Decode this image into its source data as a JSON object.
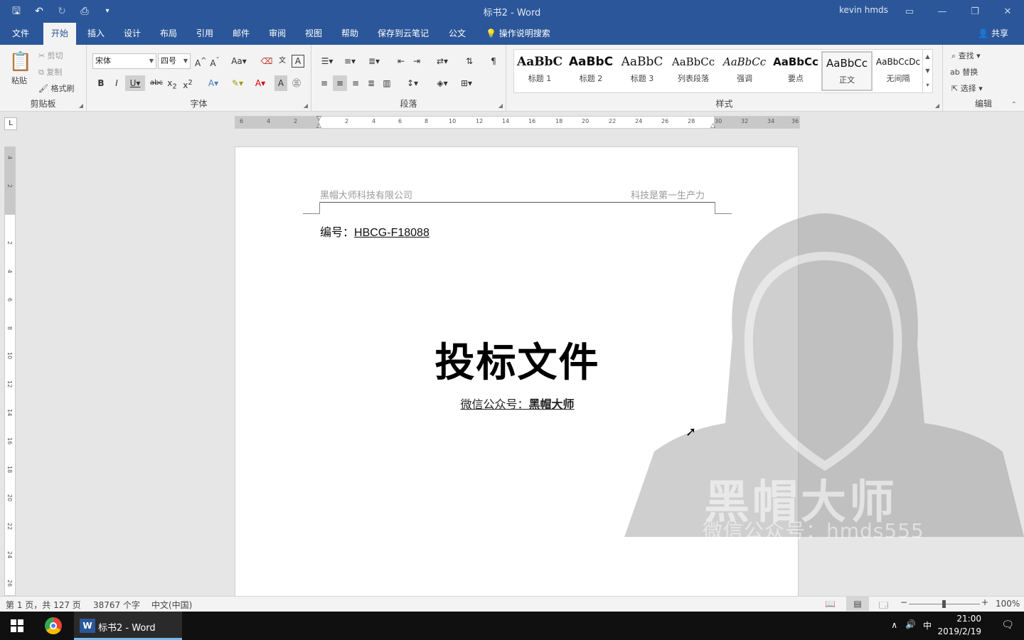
{
  "window": {
    "title": "标书2 - Word",
    "user": "kevin hmds"
  },
  "qat": {
    "save_icon": "save-icon",
    "undo_icon": "undo-icon",
    "redo_icon": "redo-icon",
    "preview_icon": "print-preview-icon",
    "customize_icon": "customize-icon"
  },
  "tabs": [
    "文件",
    "开始",
    "插入",
    "设计",
    "布局",
    "引用",
    "邮件",
    "审阅",
    "视图",
    "帮助",
    "保存到云笔记",
    "公文",
    "操作说明搜索"
  ],
  "active_tab": "开始",
  "share_label": "共享",
  "clipboard": {
    "paste": "粘贴",
    "cut": "剪切",
    "copy": "复制",
    "format_painter": "格式刷",
    "label": "剪贴板"
  },
  "font": {
    "name": "宋体",
    "size": "四号",
    "label": "字体"
  },
  "paragraph": {
    "label": "段落"
  },
  "styles": {
    "label": "样式",
    "items": [
      {
        "preview": "AaBbC",
        "name": "标题 1"
      },
      {
        "preview": "AaBbC",
        "name": "标题 2"
      },
      {
        "preview": "AaBbC",
        "name": "标题 3"
      },
      {
        "preview": "AaBbCc",
        "name": "列表段落"
      },
      {
        "preview": "AaBbCc",
        "name": "强调"
      },
      {
        "preview": "AaBbCc",
        "name": "要点"
      },
      {
        "preview": "AaBbCc",
        "name": "正文"
      },
      {
        "preview": "AaBbCcDc",
        "name": "无间隔"
      }
    ]
  },
  "editing": {
    "find": "查找",
    "replace": "替换",
    "select": "选择",
    "label": "编辑"
  },
  "hruler_ticks": [
    "6",
    "4",
    "2",
    "2",
    "4",
    "6",
    "8",
    "10",
    "12",
    "14",
    "16",
    "18",
    "20",
    "22",
    "24",
    "26",
    "28",
    "30",
    "32",
    "34",
    "36"
  ],
  "vruler_ticks": [
    "4",
    "2",
    "2",
    "4",
    "6",
    "8",
    "10",
    "12",
    "14",
    "16",
    "18",
    "20",
    "22",
    "24",
    "26"
  ],
  "document": {
    "header_left": "黑帽大师科技有限公司",
    "header_right": "科技是第一生产力",
    "code_label": "编号：",
    "code_value": "HBCG-F18088",
    "title": "投标文件",
    "wechat_label": "微信公众号：",
    "wechat_value": "黑帽大师"
  },
  "watermark": {
    "main": "黑帽大师",
    "sub": "微信公众号：hmds555"
  },
  "status": {
    "page": "第 1 页，共 127 页",
    "words": "38767 个字",
    "lang": "中文(中国)",
    "zoom": "100%"
  },
  "taskbar": {
    "word_label": "标书2 - Word",
    "ime": "中",
    "time": "21:00",
    "date": "2019/2/19"
  }
}
